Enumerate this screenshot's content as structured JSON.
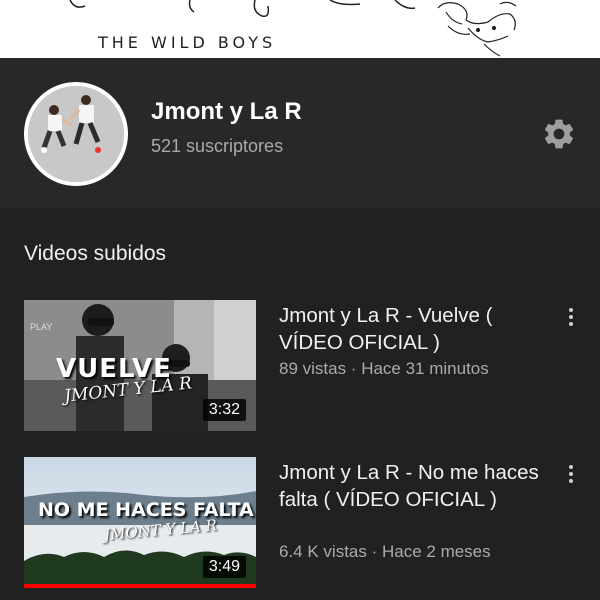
{
  "banner": {
    "text": "THE WILD BOYS"
  },
  "channel": {
    "name": "Jmont y La R",
    "subscribers": "521 suscriptores",
    "settings_icon": "gear-icon"
  },
  "section": {
    "title": "Videos subidos"
  },
  "videos": [
    {
      "title": "Jmont y La R - Vuelve ( VÍDEO OFICIAL )",
      "meta": "89 vistas · Hace 31 minutos",
      "duration": "3:32",
      "thumb_title": "VUELVE",
      "thumb_script": "JMONT Y LA R",
      "thumb_small": "PLAY",
      "watched_fraction": 0
    },
    {
      "title": "Jmont y La R - No me haces falta ( VÍDEO OFICIAL )",
      "meta": "6.4 K vistas · Hace 2 meses",
      "duration": "3:49",
      "thumb_title": "NO ME HACES FALTA",
      "thumb_script": "JMONT Y LA R",
      "watched_fraction": 1
    }
  ],
  "colors": {
    "background": "#212121",
    "header": "#282828",
    "secondary_text": "#aaaaaa",
    "progress": "#ff0000"
  }
}
